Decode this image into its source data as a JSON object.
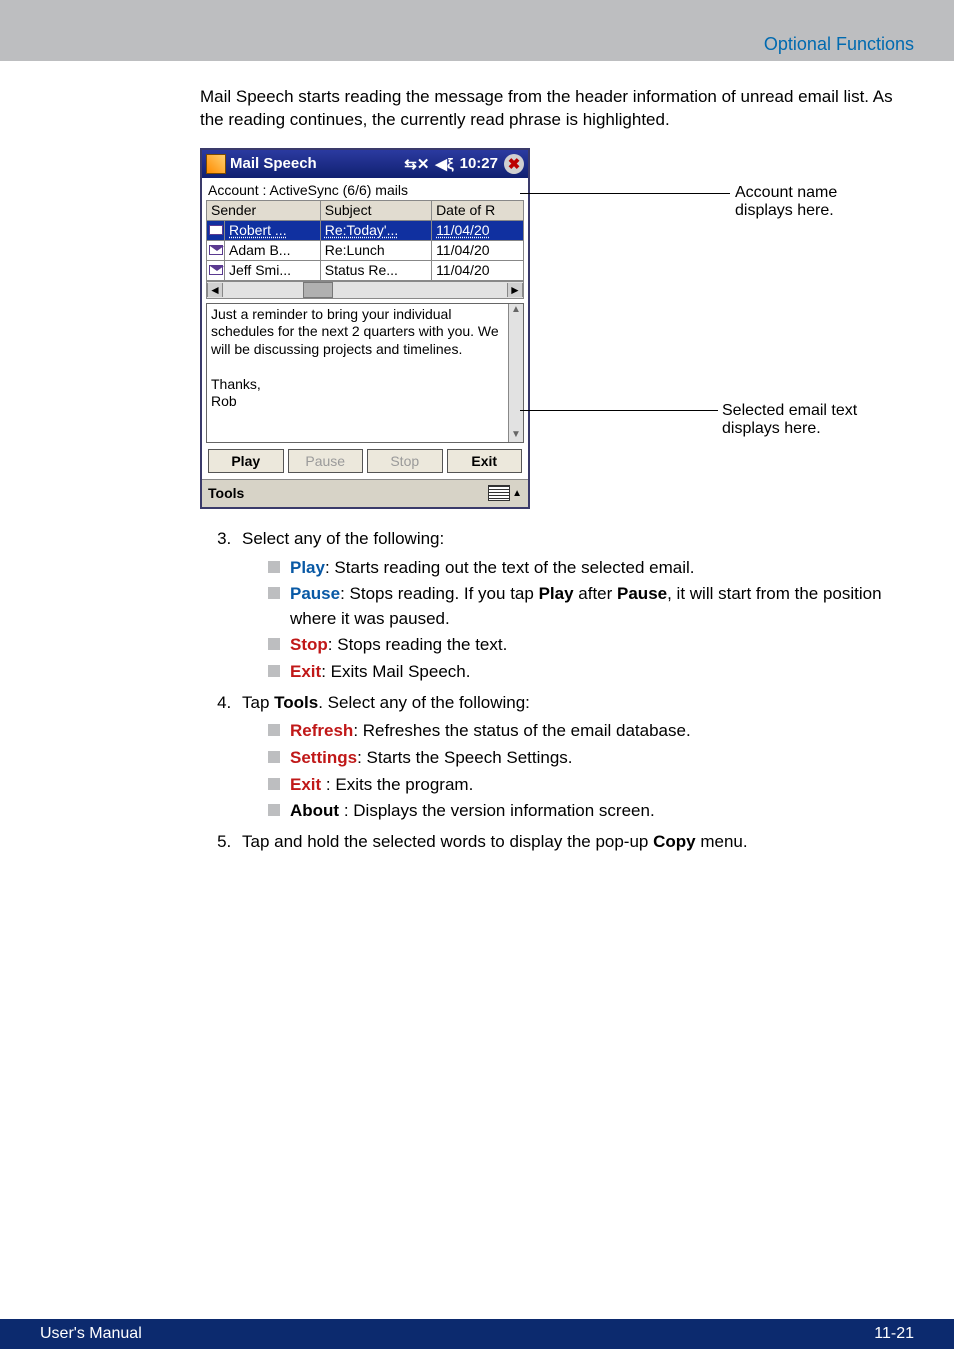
{
  "header": {
    "section": "Optional Functions"
  },
  "intro": "Mail Speech starts reading the message from the header information of unread email list. As the reading continues, the currently read phrase is highlighted.",
  "screenshot": {
    "title": "Mail Speech",
    "clock": "10:27",
    "account_line": "Account :   ActiveSync  (6/6) mails",
    "columns": {
      "sender": "Sender",
      "subject": "Subject",
      "date": "Date of R"
    },
    "rows": [
      {
        "sender": "Robert ...",
        "subject": "Re:Today'...",
        "date": "11/04/20",
        "selected": true
      },
      {
        "sender": "Adam B...",
        "subject": "Re:Lunch",
        "date": "11/04/20",
        "selected": false
      },
      {
        "sender": "Jeff Smi...",
        "subject": "Status Re...",
        "date": "11/04/20",
        "selected": false
      }
    ],
    "body": "Just a reminder to bring your individual schedules for the next 2 quarters with you. We will be discussing projects and timelines.\n\nThanks,\nRob",
    "buttons": {
      "play": "Play",
      "pause": "Pause",
      "stop": "Stop",
      "exit": "Exit"
    },
    "menubar": "Tools"
  },
  "callouts": {
    "account": "Account name displays here.",
    "body": "Selected email text displays here."
  },
  "steps": {
    "s3": {
      "lead": "Select any of the following:",
      "items": [
        {
          "term": "Play",
          "desc": ": Starts reading out the text of the selected email."
        },
        {
          "term": "Pause",
          "desc_a": ": Stops reading. If you tap ",
          "mid1": "Play",
          "desc_b": " after ",
          "mid2": "Pause",
          "desc_c": ", it will start from the position where it was paused."
        },
        {
          "term": "Stop",
          "desc": ": Stops reading the text."
        },
        {
          "term": "Exit",
          "desc": ": Exits Mail Speech."
        }
      ]
    },
    "s4": {
      "lead_a": "Tap ",
      "lead_b": "Tools",
      "lead_c": ". Select any of the following:",
      "items": [
        {
          "term": "Refresh",
          "desc": ": Refreshes the status of the email database."
        },
        {
          "term": "Settings",
          "desc": ": Starts the Speech Settings."
        },
        {
          "term": "Exit",
          "desc": "    : Exits the program."
        },
        {
          "term": "About",
          "desc": " : Displays the version information screen."
        }
      ]
    },
    "s5": {
      "text_a": "Tap and hold the selected words to display the pop-up ",
      "text_b": "Copy",
      "text_c": " menu."
    }
  },
  "footer": {
    "left": "User's Manual",
    "right": "11-21"
  }
}
